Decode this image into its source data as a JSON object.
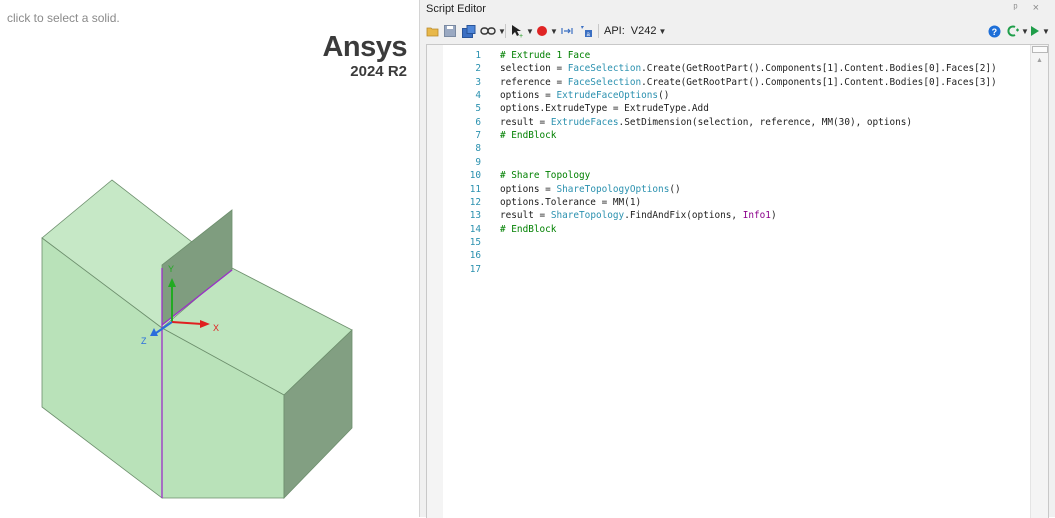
{
  "viewport": {
    "hint": "click to select a solid.",
    "logo": {
      "brand": "Ansys",
      "version": "2024 R2"
    },
    "triad": {
      "x_label": "X",
      "y_label": "Y",
      "z_label": "Z"
    },
    "colors": {
      "solid_top": "#c5e7c5",
      "solid_front": "#b7e0b7",
      "solid_side": "#7f9c7f",
      "edge": "#9b30c8"
    }
  },
  "editor": {
    "title": "Script Editor",
    "window_buttons": "ᵖ ×",
    "toolbar": {
      "api_label": "API:",
      "api_value": "V242",
      "items": [
        "open-icon",
        "save-icon",
        "save-as-icon",
        "link-icon",
        "select-tool-icon",
        "record-icon",
        "step-icon",
        "debug-icon",
        "help-icon",
        "run-config-icon",
        "run-icon"
      ]
    },
    "lines": [
      {
        "n": "1",
        "segs": [
          {
            "t": "# Extrude 1 Face",
            "c": "cm"
          }
        ]
      },
      {
        "n": "2",
        "segs": [
          {
            "t": "selection = ",
            "c": ""
          },
          {
            "t": "FaceSelection",
            "c": "ty"
          },
          {
            "t": ".Create(GetRootPart().Components[1].Content.Bodies[0].Faces[2])",
            "c": ""
          }
        ]
      },
      {
        "n": "3",
        "segs": [
          {
            "t": "reference = ",
            "c": ""
          },
          {
            "t": "FaceSelection",
            "c": "ty"
          },
          {
            "t": ".Create(GetRootPart().Components[1].Content.Bodies[0].Faces[3])",
            "c": ""
          }
        ]
      },
      {
        "n": "4",
        "segs": [
          {
            "t": "options = ",
            "c": ""
          },
          {
            "t": "ExtrudeFaceOptions",
            "c": "ty"
          },
          {
            "t": "()",
            "c": ""
          }
        ]
      },
      {
        "n": "5",
        "segs": [
          {
            "t": "options.ExtrudeType = ExtrudeType.Add",
            "c": ""
          }
        ]
      },
      {
        "n": "6",
        "segs": [
          {
            "t": "result = ",
            "c": ""
          },
          {
            "t": "ExtrudeFaces",
            "c": "ty"
          },
          {
            "t": ".SetDimension(selection, reference, MM(30), options)",
            "c": ""
          }
        ]
      },
      {
        "n": "7",
        "segs": [
          {
            "t": "# EndBlock",
            "c": "cm"
          }
        ]
      },
      {
        "n": "8",
        "segs": []
      },
      {
        "n": "9",
        "segs": []
      },
      {
        "n": "10",
        "segs": [
          {
            "t": "# Share Topology",
            "c": "cm"
          }
        ]
      },
      {
        "n": "11",
        "segs": [
          {
            "t": "options = ",
            "c": ""
          },
          {
            "t": "ShareTopologyOptions",
            "c": "ty"
          },
          {
            "t": "()",
            "c": ""
          }
        ]
      },
      {
        "n": "12",
        "segs": [
          {
            "t": "options.Tolerance = MM(1)",
            "c": ""
          }
        ]
      },
      {
        "n": "13",
        "segs": [
          {
            "t": "result = ",
            "c": ""
          },
          {
            "t": "ShareTopology",
            "c": "ty"
          },
          {
            "t": ".FindAndFix(options, ",
            "c": ""
          },
          {
            "t": "Info1",
            "c": "en"
          },
          {
            "t": ")",
            "c": ""
          }
        ]
      },
      {
        "n": "14",
        "segs": [
          {
            "t": "# EndBlock",
            "c": "cm"
          }
        ]
      },
      {
        "n": "15",
        "segs": []
      },
      {
        "n": "16",
        "segs": []
      },
      {
        "n": "17",
        "segs": []
      }
    ]
  }
}
